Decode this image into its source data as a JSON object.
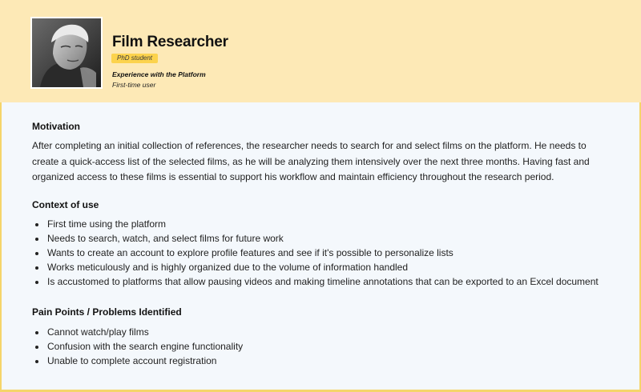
{
  "persona": {
    "name": "Film Researcher",
    "badge": "PhD student",
    "experience_label": "Experience with the Platform",
    "experience_value": "First-time user",
    "photo_icon": "portrait-photo"
  },
  "colors": {
    "header_bg": "#fde9b6",
    "badge_bg": "#fcd34d",
    "body_bg": "#f4f8fc",
    "border": "#f5d56a"
  },
  "motivation": {
    "title": "Motivation",
    "text": "After completing an initial collection of references, the researcher needs to search for and select films on the platform.  He needs to create a quick-access list of the selected films, as he will be analyzing them intensively over the next three months.  Having fast and organized access to these films is essential to support his workflow and maintain efficiency throughout the research period."
  },
  "context": {
    "title": "Context of use",
    "items": [
      "First time using the platform",
      "Needs to search, watch, and select films for future work",
      "Wants to create an account to explore profile features and see if it's possible to personalize lists",
      "Works meticulously and is highly organized due to the volume of information handled",
      "Is accustomed to platforms that allow pausing videos and making timeline annotations that can be exported to an Excel document"
    ]
  },
  "pain_points": {
    "title": "Pain Points / Problems Identified",
    "items": [
      "Cannot watch/play films",
      "Confusion with the search engine functionality",
      "Unable to complete account registration"
    ]
  }
}
